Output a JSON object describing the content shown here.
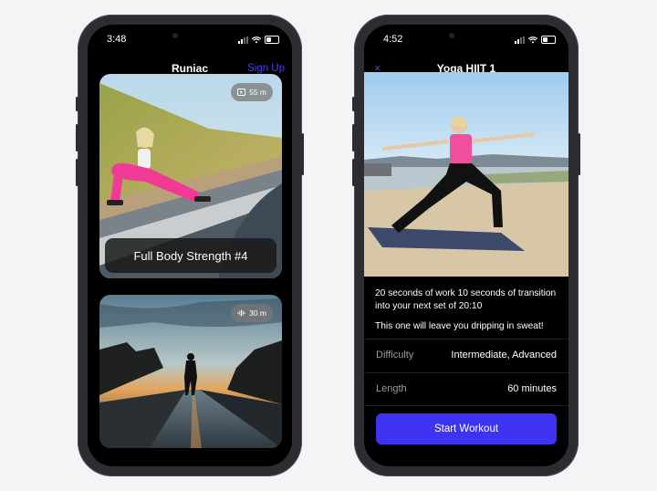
{
  "left_phone": {
    "status_time": "3:48",
    "title": "Runiac",
    "signup_label": "Sign Up",
    "cards": [
      {
        "duration": "55 m",
        "duration_icon": "video-icon",
        "title": "Full Body Strength #4"
      },
      {
        "duration": "30 m",
        "duration_icon": "audio-wave-icon",
        "title": ""
      }
    ]
  },
  "right_phone": {
    "status_time": "4:52",
    "title": "Yoga HIIT 1",
    "close_icon": "×",
    "description_1": "20 seconds of work 10 seconds of transition into your next set of 20:10",
    "description_2": "This one will leave you dripping in sweat!",
    "details": [
      {
        "label": "Difficulty",
        "value": "Intermediate, Advanced"
      },
      {
        "label": "Length",
        "value": "60 minutes"
      }
    ],
    "start_label": "Start Workout"
  },
  "colors": {
    "accent": "#3d33f0",
    "background": "#f2f4f5",
    "screen": "#000000"
  }
}
